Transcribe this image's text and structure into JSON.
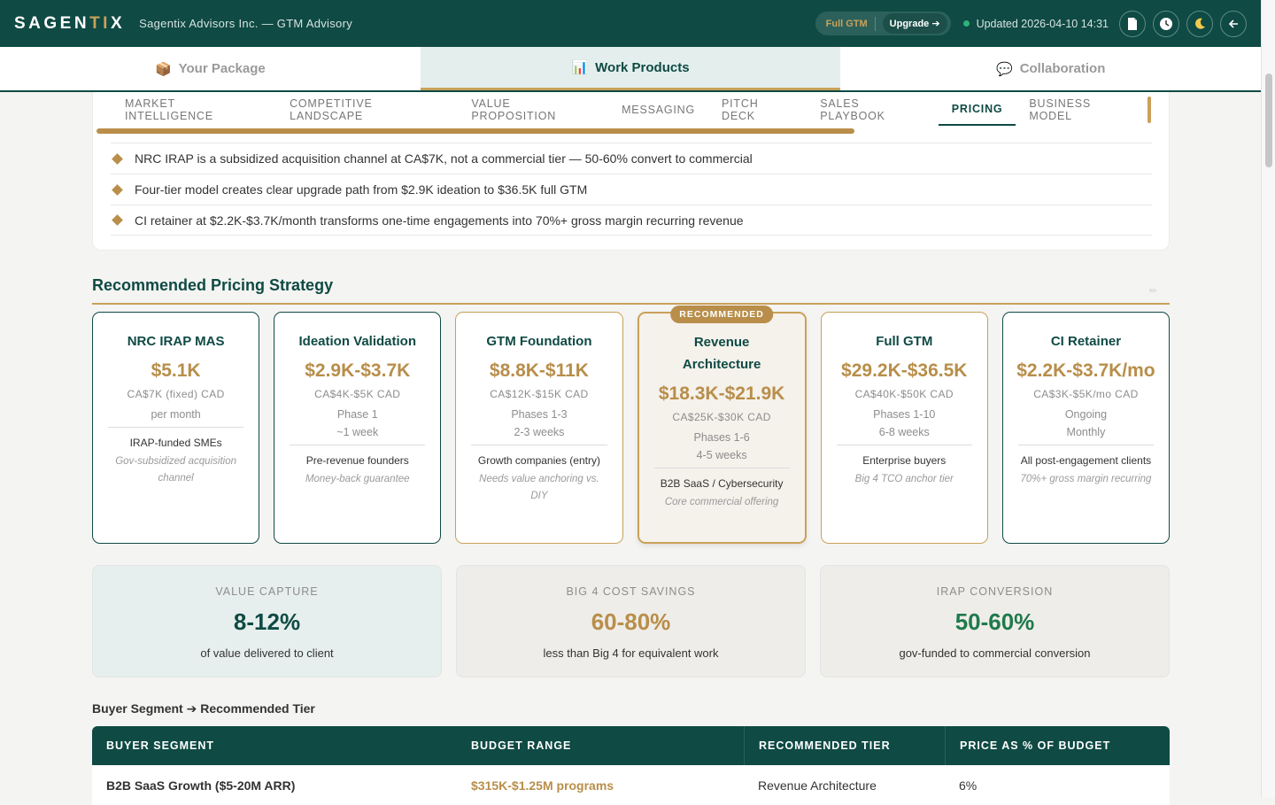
{
  "topbar": {
    "logo_main": "SAGEN",
    "logo_accent": "TI",
    "logo_end": "X",
    "company": "Sagentix Advisors Inc. — GTM Advisory",
    "plan": "Full GTM",
    "upgrade": "Upgrade ➔",
    "updated": "Updated 2026-04-10 14:31"
  },
  "main_tabs": [
    {
      "icon": "📦",
      "label": "Your Package"
    },
    {
      "icon": "📊",
      "label": "Work Products"
    },
    {
      "icon": "💬",
      "label": "Collaboration"
    }
  ],
  "sub_tabs": [
    "MARKET INTELLIGENCE",
    "COMPETITIVE LANDSCAPE",
    "VALUE PROPOSITION",
    "MESSAGING",
    "PITCH DECK",
    "SALES PLAYBOOK",
    "PRICING",
    "BUSINESS MODEL"
  ],
  "bullets": [
    "NRC IRAP is a subsidized acquisition channel at CA$7K, not a commercial tier — 50-60% convert to commercial",
    "Four-tier model creates clear upgrade path from $2.9K ideation to $36.5K full GTM",
    "CI retainer at $2.2K-$3.7K/month transforms one-time engagements into 70%+ gross margin recurring revenue"
  ],
  "section_title": "Recommended Pricing Strategy",
  "recommended_badge": "RECOMMENDED",
  "tiers": [
    {
      "name": "NRC IRAP MAS",
      "price": "$5.1K",
      "cad": "CA$7K (fixed) CAD",
      "l1": "per month",
      "l2": "",
      "audience": "IRAP-funded SMEs",
      "note": "Gov-subsidized acquisition channel"
    },
    {
      "name": "Ideation Validation",
      "price": "$2.9K-$3.7K",
      "cad": "CA$4K-$5K CAD",
      "l1": "Phase 1",
      "l2": "~1 week",
      "audience": "Pre-revenue founders",
      "note": "Money-back guarantee"
    },
    {
      "name": "GTM Foundation",
      "price": "$8.8K-$11K",
      "cad": "CA$12K-$15K CAD",
      "l1": "Phases 1-3",
      "l2": "2-3 weeks",
      "audience": "Growth companies (entry)",
      "note": "Needs value anchoring vs. DIY"
    },
    {
      "name": "Revenue Architecture",
      "price": "$18.3K-$21.9K",
      "cad": "CA$25K-$30K CAD",
      "l1": "Phases 1-6",
      "l2": "4-5 weeks",
      "audience": "B2B SaaS / Cybersecurity",
      "note": "Core commercial offering"
    },
    {
      "name": "Full GTM",
      "price": "$29.2K-$36.5K",
      "cad": "CA$40K-$50K CAD",
      "l1": "Phases 1-10",
      "l2": "6-8 weeks",
      "audience": "Enterprise buyers",
      "note": "Big 4 TCO anchor tier"
    },
    {
      "name": "CI Retainer",
      "price": "$2.2K-$3.7K/mo",
      "cad": "CA$3K-$5K/mo CAD",
      "l1": "Ongoing",
      "l2": "Monthly",
      "audience": "All post-engagement clients",
      "note": "70%+ gross margin recurring"
    }
  ],
  "metrics": [
    {
      "label": "VALUE CAPTURE",
      "value": "8-12%",
      "sub": "of value delivered to client",
      "color": "#0f4a44"
    },
    {
      "label": "BIG 4 COST SAVINGS",
      "value": "60-80%",
      "sub": "less than Big 4 for equivalent work",
      "color": "#b88e4a"
    },
    {
      "label": "IRAP CONVERSION",
      "value": "50-60%",
      "sub": "gov-funded to commercial conversion",
      "color": "#1f7a4c"
    }
  ],
  "table_title": "Buyer Segment ➔ Recommended Tier",
  "table": {
    "headers": [
      "BUYER SEGMENT",
      "BUDGET RANGE",
      "RECOMMENDED TIER",
      "PRICE AS % OF BUDGET"
    ],
    "rows": [
      [
        "B2B SaaS Growth ($5-20M ARR)",
        "$315K-$1.25M programs",
        "Revenue Architecture",
        "6%"
      ]
    ]
  }
}
